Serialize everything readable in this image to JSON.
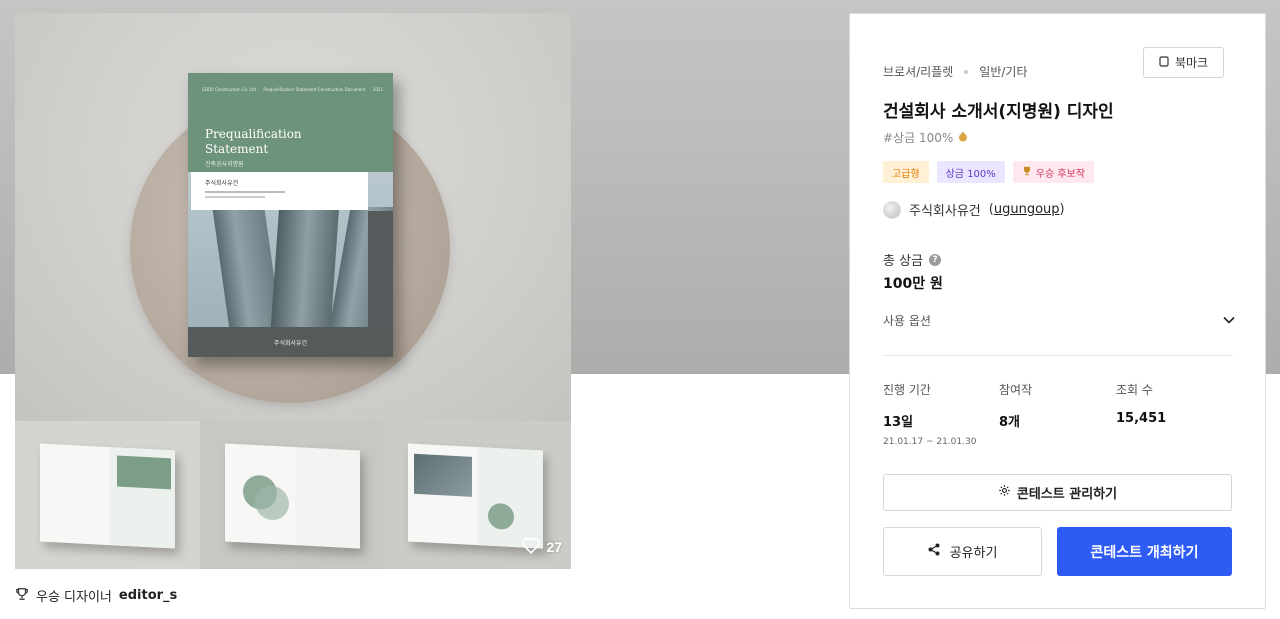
{
  "gallery": {
    "cover": {
      "head_left": "GDD5 Construction Co. Ltd",
      "head_mid": "Prequalification Statement Construction Document",
      "head_right": "2021",
      "title_line1": "Prequalification",
      "title_line2": "Statement",
      "subtitle": "건축공사지명원",
      "card_label": "주식회사유건",
      "footer_brand": "주식회사유건"
    },
    "like_count": "27"
  },
  "winner": {
    "label": "우승 디자이너",
    "designer": "editor_s"
  },
  "panel": {
    "category": "브로셔/리플렛",
    "subcategory": "일반/기타",
    "bookmark_label": "북마크",
    "title": "건설회사 소개서(지명원) 디자인",
    "hashtag": "#상금 100%",
    "badges": [
      "고급형",
      "상금 100%",
      "우승 후보작"
    ],
    "host_name": "주식회사유건",
    "host_handle": "ugungoup",
    "prize_label": "총 상금",
    "prize_value": "100만 원",
    "usage_label": "사용 옵션",
    "stats": {
      "duration_label": "진행 기간",
      "duration_value": "13일",
      "dates": "21.01.17 ~ 21.01.30",
      "entries_label": "참여작",
      "entries_value": "8개",
      "views_label": "조회 수",
      "views_value": "15,451"
    },
    "manage_label": "콘테스트 관리하기",
    "share_label": "공유하기",
    "host_label": "콘테스트 개최하기"
  },
  "colors": {
    "primary": "#2f5bf5",
    "cover_green": "#6e937d",
    "badge_gold": "#e07b00",
    "badge_purple": "#5a3ac4",
    "badge_pink": "#d23264"
  },
  "icons": [
    "bookmark-icon",
    "moneybag-icon",
    "trophy-icon",
    "help-icon",
    "chevron-down-icon",
    "gear-icon",
    "share-icon",
    "heart-icon"
  ]
}
